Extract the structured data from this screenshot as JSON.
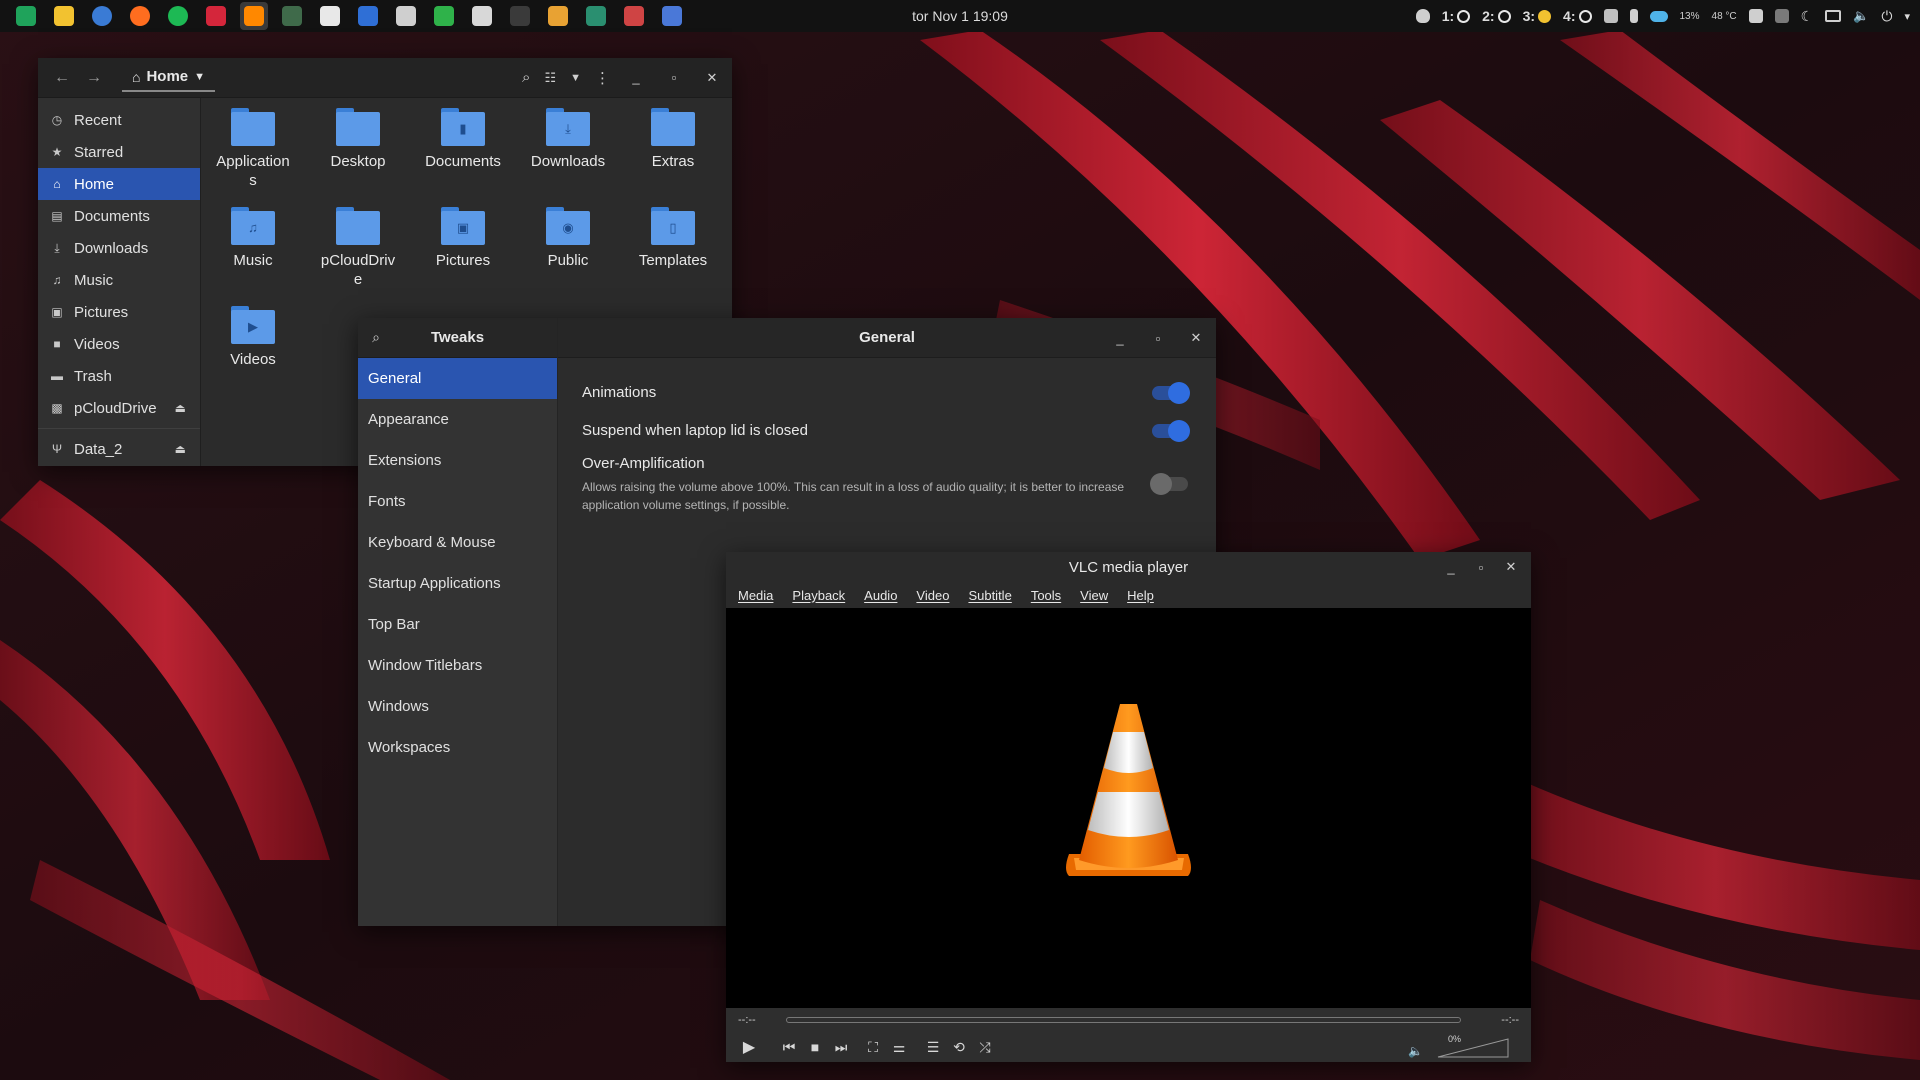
{
  "topbar": {
    "clock": "tor Nov 1  19:09",
    "workspaces": [
      {
        "label": "1:",
        "state": "ring"
      },
      {
        "label": "2:",
        "state": "ring"
      },
      {
        "label": "3:",
        "state": "yellow"
      },
      {
        "label": "4:",
        "state": "ring"
      }
    ],
    "cpu": "13%",
    "temp": "48 °C",
    "app_icons": [
      "menu-icon",
      "notes-icon",
      "thunderbird-icon",
      "firefox-icon",
      "spotify-icon",
      "video-downloader-icon",
      "vlc-icon",
      "system-monitor-icon",
      "text-editor-icon",
      "qbittorrent-icon",
      "calculator-icon",
      "refresh-icon",
      "draw-icon",
      "terminal-icon",
      "download-icon",
      "plugin-icon",
      "virtualbox-icon",
      "screenshot-icon"
    ]
  },
  "files": {
    "path": "Home",
    "sidebar": [
      {
        "label": "Recent",
        "icon": "clock-icon"
      },
      {
        "label": "Starred",
        "icon": "star-icon"
      },
      {
        "label": "Home",
        "icon": "home-icon",
        "selected": true
      },
      {
        "label": "Documents",
        "icon": "document-icon"
      },
      {
        "label": "Downloads",
        "icon": "download-icon"
      },
      {
        "label": "Music",
        "icon": "music-icon"
      },
      {
        "label": "Pictures",
        "icon": "picture-icon"
      },
      {
        "label": "Videos",
        "icon": "video-icon"
      },
      {
        "label": "Trash",
        "icon": "trash-icon"
      },
      {
        "label": "pCloudDrive",
        "icon": "drive-icon"
      },
      {
        "label": "Data_2",
        "icon": "usb-icon"
      }
    ],
    "folders": [
      {
        "label": "Application\ns",
        "glyph": ""
      },
      {
        "label": "Desktop",
        "glyph": ""
      },
      {
        "label": "Documents",
        "glyph": "▮"
      },
      {
        "label": "Downloads",
        "glyph": "⤓"
      },
      {
        "label": "Extras",
        "glyph": ""
      },
      {
        "label": "Music",
        "glyph": "♫"
      },
      {
        "label": "pCloudDriv\ne",
        "glyph": ""
      },
      {
        "label": "Pictures",
        "glyph": "▣"
      },
      {
        "label": "Public",
        "glyph": "◉"
      },
      {
        "label": "Templates",
        "glyph": "▯"
      },
      {
        "label": "Videos",
        "glyph": "▶"
      }
    ]
  },
  "tweaks": {
    "title": "Tweaks",
    "section_title": "General",
    "categories": [
      "General",
      "Appearance",
      "Extensions",
      "Fonts",
      "Keyboard & Mouse",
      "Startup Applications",
      "Top Bar",
      "Window Titlebars",
      "Windows",
      "Workspaces"
    ],
    "settings": {
      "animations": {
        "label": "Animations",
        "on": true
      },
      "suspend": {
        "label": "Suspend when laptop lid is closed",
        "on": true
      },
      "overamp": {
        "label": "Over-Amplification",
        "desc": "Allows raising the volume above 100%. This can result in a loss of audio quality; it is better to increase application volume settings, if possible.",
        "on": false
      }
    }
  },
  "vlc": {
    "title": "VLC media player",
    "menu": [
      "Media",
      "Playback",
      "Audio",
      "Video",
      "Subtitle",
      "Tools",
      "View",
      "Help"
    ],
    "time_elapsed": "--:--",
    "time_total": "--:--",
    "volume": "0%"
  },
  "colors": {
    "accent": "#2a55b0",
    "folder": "#5c9ae8",
    "cone_orange": "#f07a0c"
  }
}
